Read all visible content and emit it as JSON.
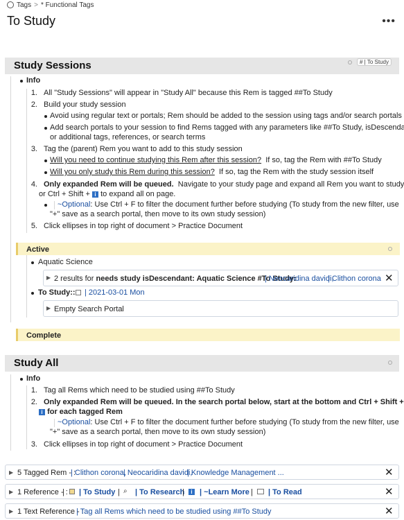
{
  "breadcrumb": {
    "items": [
      "Tags",
      "* Functional Tags"
    ],
    "separator": ">"
  },
  "page": {
    "title": "To Study",
    "more": "•••"
  },
  "study_sessions": {
    "heading": "Study Sessions",
    "tag_chip": "# | To Study",
    "info_label": "Info",
    "items": [
      "All \"Study Sessions\" will appear in \"Study All\" because this Rem is tagged ##To Study",
      "Build your study session",
      "Tag the (parent) Rem you want to add to this study session",
      "Only expanded Rem will be queued.",
      "Click ellipses in top right of document > Practice Document"
    ],
    "nums": [
      "1.",
      "2.",
      "3.",
      "4.",
      "5."
    ],
    "build_bullets": [
      "Avoid using regular text or portals; Rem should be added to the session using tags and/or search portals",
      "Add search portals to your session to find Rems tagged with any parameters like ##To Study, isDescendant,",
      "or additional tags, references, or search terms"
    ],
    "tag_bullets": [
      {
        "q": "Will you need to continue studying this Rem after this session?",
        "a": "If so, tag the Rem with ##To Study"
      },
      {
        "q": "Will you only study this Rem during this session?",
        "a": "If so, tag the Rem with the study session itself"
      }
    ],
    "item4_rest": "Navigate to your study page and expand all Rem you want to study",
    "item4_line2a": "or Ctrl + Shift +",
    "item4_line2b": "to expand all on page.",
    "optional_label": "~Optional",
    "optional_line1": ": Use Ctrl + F to filter the document further before studying (To study from the new filter, use",
    "optional_line2": "\"+\" save as a search portal, then move to its own study session)"
  },
  "active": {
    "label": "Active",
    "aquatic": "Aquatic Science",
    "portal_prefix": "2 results for",
    "portal_query": "needs study isDescendant: Aquatic Science #To Study:",
    "portal_results": [
      "Neocaridina davidi,",
      "Clithon corona"
    ],
    "to_study_label": "To Study::",
    "date": "2021-03-01 Mon",
    "empty_portal": "Empty Search Portal"
  },
  "complete": {
    "label": "Complete"
  },
  "study_all": {
    "heading": "Study All",
    "info_label": "Info",
    "nums": [
      "1.",
      "2.",
      "3."
    ],
    "item1": "Tag all Rems which need to be studied using ##To Study",
    "item2_line1": "Only expanded Rem will be queued.  In the search portal below, start at the bottom and Ctrl + Shift +",
    "item2_line2": "for each tagged Rem",
    "optional_label": "~Optional",
    "optional_line1": ": Use Ctrl + F to filter the document further before studying (To study from the new filter, use",
    "optional_line2": "\"+\" save as a search portal, then move to its own study session)",
    "item3": "Click ellipses in top right of document > Practice Document"
  },
  "footer": {
    "tagged": {
      "label": "5 Tagged Rem - :",
      "links": [
        "Clithon corona,",
        "Neocaridina davidi,",
        "Knowledge Management ..."
      ]
    },
    "reference": {
      "label": "1 Reference - :",
      "links": [
        "To Study",
        "To Research",
        "~Learn More",
        "To Read"
      ]
    },
    "text_reference": {
      "label": "1 Text Reference - :",
      "link": "Tag all Rems which need to be studied using ##To Study"
    }
  },
  "icons": {
    "close": "close-icon",
    "caret": "caret-right-icon",
    "info": "info-icon",
    "calendar": "calendar-icon",
    "search": "search-icon",
    "checkbox": "checkbox-icon"
  },
  "colors": {
    "band": "#e6e6e6",
    "yellow": "#fbf3c8",
    "link": "#1a4fa0",
    "info_icon": "#2d6fc4"
  }
}
